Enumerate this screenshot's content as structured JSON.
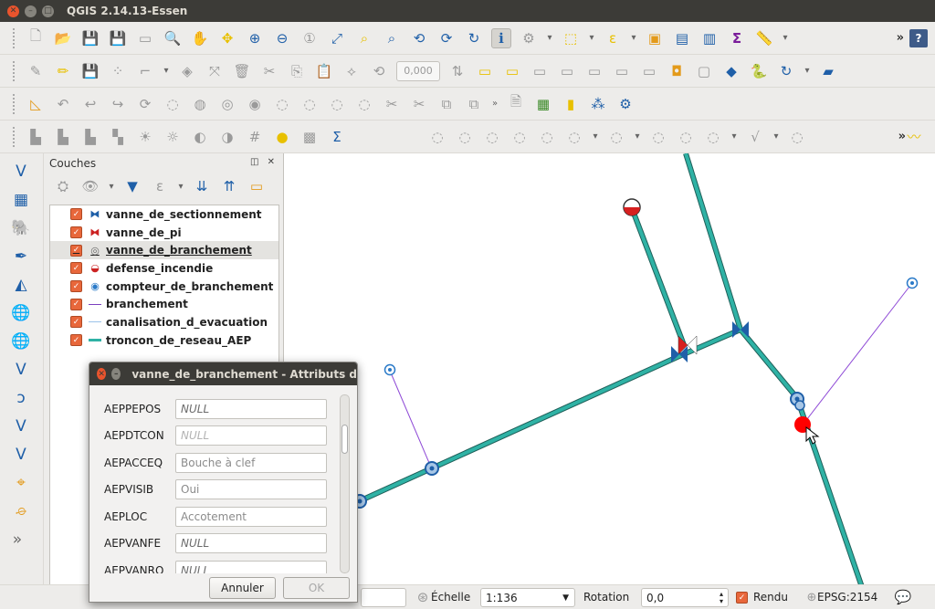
{
  "window": {
    "title": "QGIS 2.14.13-Essen"
  },
  "toolbar": {
    "spin_value": "0,000",
    "more": "»",
    "help": "?"
  },
  "layers_panel": {
    "title": "Couches",
    "controls": "◫ ✕",
    "layers": [
      {
        "name": "vanne_de_sectionnement",
        "symbol": "valve-blue-icon",
        "color": "#1f5fa8"
      },
      {
        "name": "vanne_de_pi",
        "symbol": "valve-red-icon",
        "color": "#cc2222"
      },
      {
        "name": "vanne_de_branchement",
        "symbol": "gear-circle-icon",
        "color": "#666666",
        "selected": true
      },
      {
        "name": "defense_incendie",
        "symbol": "half-circle-red-icon",
        "color": "#cc2222"
      },
      {
        "name": "compteur_de_branchement",
        "symbol": "target-blue-icon",
        "color": "#2a7ac8"
      },
      {
        "name": "branchement",
        "symbol": "line-purple-icon",
        "color": "#7b3fbf"
      },
      {
        "name": "canalisation_d_evacuation",
        "symbol": "line-lightblue-icon",
        "color": "#9cc3ea"
      },
      {
        "name": "troncon_de_reseau_AEP",
        "symbol": "line-teal-icon",
        "color": "#2fb2a5"
      }
    ]
  },
  "dialog": {
    "title": "vanne_de_branchement - Attributs d",
    "fields": [
      {
        "label": "AEPPEPOS",
        "value": "NULL",
        "null": true
      },
      {
        "label": "AEPDTCON",
        "value": "NULL",
        "null": true,
        "dim": true
      },
      {
        "label": "AEPACCEQ",
        "value": "Bouche à clef"
      },
      {
        "label": "AEPVISIB",
        "value": "Oui"
      },
      {
        "label": "AEPLOC",
        "value": "Accotement"
      },
      {
        "label": "AEPVANFE",
        "value": "NULL",
        "null": true
      },
      {
        "label": "AEPVANRO",
        "value": "NULL",
        "null": true
      }
    ],
    "cancel_label": "Annuler",
    "ok_label": "OK"
  },
  "statusbar": {
    "scale_label": "Échelle",
    "scale_value": "1:136",
    "rotation_label": "Rotation",
    "rotation_value": "0,0",
    "render_label": "Rendu",
    "crs": "EPSG:2154"
  },
  "map": {
    "pipe_color": "#2fb2a5",
    "branch_color": "#8e49d6",
    "selection_color": "#ff0000"
  }
}
